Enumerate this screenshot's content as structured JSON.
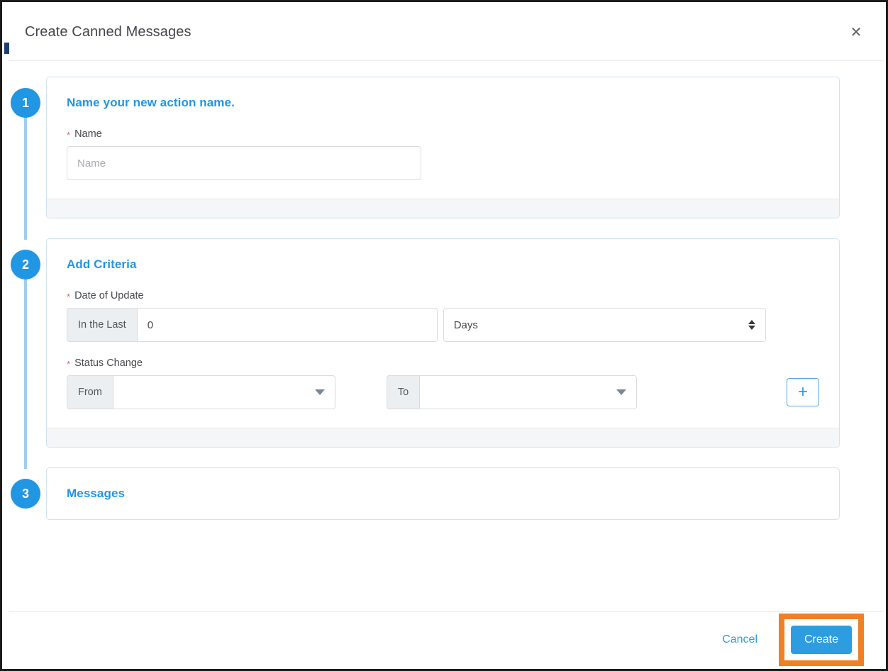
{
  "dialog": {
    "title": "Create Canned Messages",
    "close_icon": "close-icon",
    "close_label": "✕"
  },
  "steps": [
    {
      "number": "1",
      "title": "Name your new action name.",
      "fields": [
        {
          "label": "Name",
          "required_marker": "*",
          "placeholder": "Name",
          "value": ""
        }
      ]
    },
    {
      "number": "2",
      "title": "Add Criteria",
      "date_of_update": {
        "label": "Date of Update",
        "required_marker": "*",
        "prefix": "In the Last",
        "amount": "0",
        "unit": "Days",
        "unit_icon": "spinner-updown-icon"
      },
      "status_change": {
        "label": "Status Change",
        "required_marker": "*",
        "from_prefix": "From",
        "from_value": "",
        "to_prefix": "To",
        "to_value": "",
        "caret_icon": "chevron-down-icon",
        "add_label": "+",
        "add_icon": "plus-icon"
      }
    },
    {
      "number": "3",
      "title": "Messages"
    }
  ],
  "footer": {
    "cancel_label": "Cancel",
    "create_label": "Create"
  },
  "colors": {
    "accent_blue": "#2196e3",
    "button_blue": "#2e9de0",
    "highlight_orange": "#ef8023",
    "required_red": "#d96a6a",
    "card_border": "#cfe3f3",
    "connector_blue": "#9fcdf0"
  }
}
